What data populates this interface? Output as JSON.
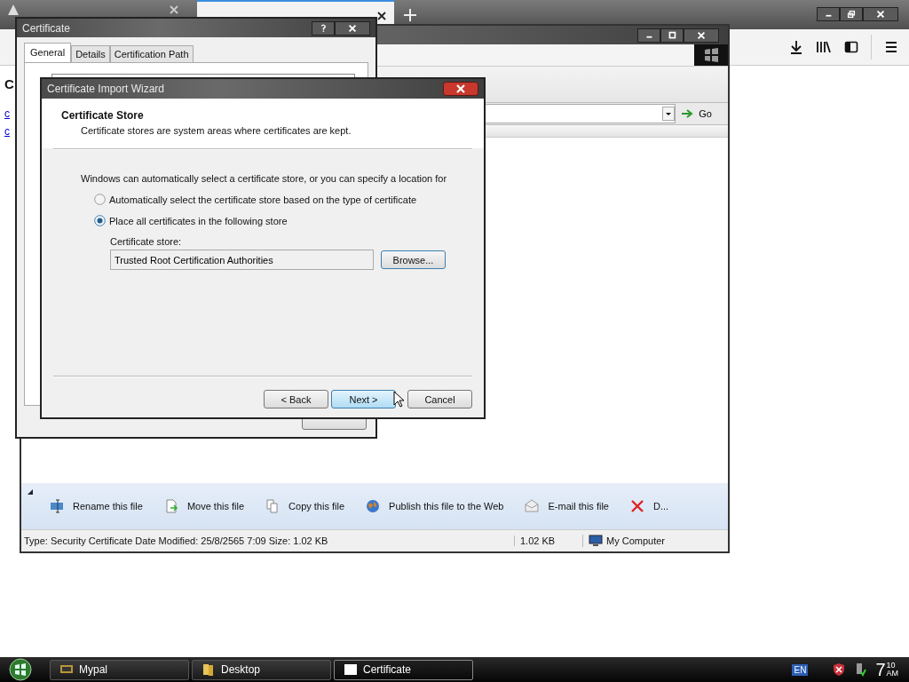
{
  "browser": {
    "tabs": [
      {
        "selected": false
      },
      {
        "selected": true
      }
    ]
  },
  "page_fragments": [
    {
      "text": "C",
      "kind": "heading"
    },
    {
      "text": "c",
      "kind": "link"
    },
    {
      "text": "c",
      "kind": "link"
    }
  ],
  "explorer": {
    "go_label": "Go",
    "tasks": [
      {
        "label": "Rename this file",
        "kind": "rename"
      },
      {
        "label": "Move this file",
        "kind": "move"
      },
      {
        "label": "Copy this file",
        "kind": "copy"
      },
      {
        "label": "Publish this file to the Web",
        "kind": "publish"
      },
      {
        "label": "E-mail this file",
        "kind": "email"
      },
      {
        "label": "D...",
        "kind": "delete"
      }
    ],
    "status": {
      "details": "Type: Security Certificate Date Modified: 25/8/2565 7:09 Size: 1.02 KB",
      "size": "1.02 KB",
      "zone": "My Computer"
    }
  },
  "certificate_dialog": {
    "title": "Certificate",
    "tabs": [
      {
        "label": "General",
        "selected": true
      },
      {
        "label": "Details",
        "selected": false
      },
      {
        "label": "Certification Path",
        "selected": false
      }
    ]
  },
  "wizard": {
    "title": "Certificate Import Wizard",
    "heading": "Certificate Store",
    "subtitle": "Certificate stores are system areas where certificates are kept.",
    "intro": "Windows can automatically select a certificate store, or you can specify a location for",
    "options": [
      {
        "label": "Automatically select the certificate store based on the type of certificate",
        "selected": false
      },
      {
        "label": "Place all certificates in the following store",
        "selected": true
      }
    ],
    "store_label": "Certificate store:",
    "store_value": "Trusted Root Certification Authorities",
    "browse_label": "Browse...",
    "buttons": [
      {
        "label": "< Back",
        "highlighted": false
      },
      {
        "label": "Next >",
        "highlighted": true
      },
      {
        "label": "Cancel",
        "highlighted": false
      }
    ]
  },
  "taskbar": {
    "items": [
      {
        "label": "Mypal",
        "kind": "app",
        "selected": false
      },
      {
        "label": "Desktop",
        "kind": "folder",
        "selected": false
      },
      {
        "label": "Certificate",
        "kind": "document",
        "selected": true
      }
    ],
    "language": "EN",
    "clock": {
      "hour": "7",
      "minute": "10",
      "period": "AM"
    }
  }
}
